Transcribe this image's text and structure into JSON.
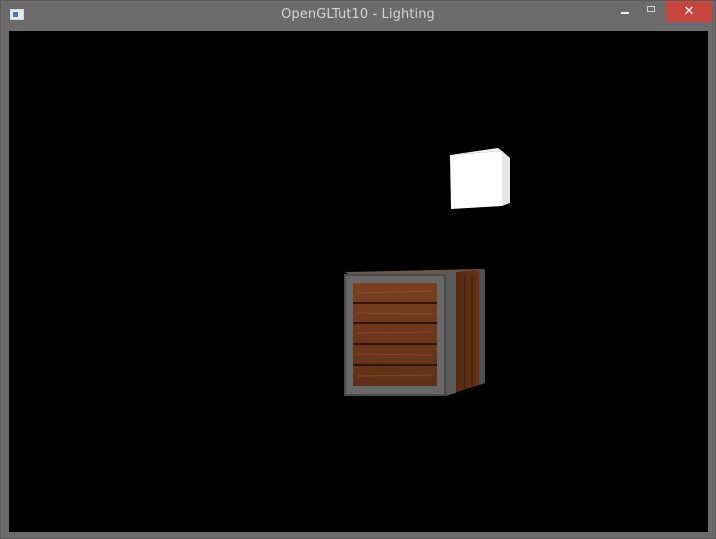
{
  "window": {
    "title": "OpenGLTut10 - Lighting",
    "icon": "app-window-icon",
    "controls": {
      "minimize_icon": "minimize-icon",
      "maximize_icon": "maximize-icon",
      "close_icon": "close-icon",
      "close_glyph": "✕"
    }
  },
  "scene": {
    "background": "#000000",
    "light_cube_color": "#ffffff",
    "crate_wood_color": "#8a4a26",
    "crate_frame_color": "#6e6e6e"
  }
}
